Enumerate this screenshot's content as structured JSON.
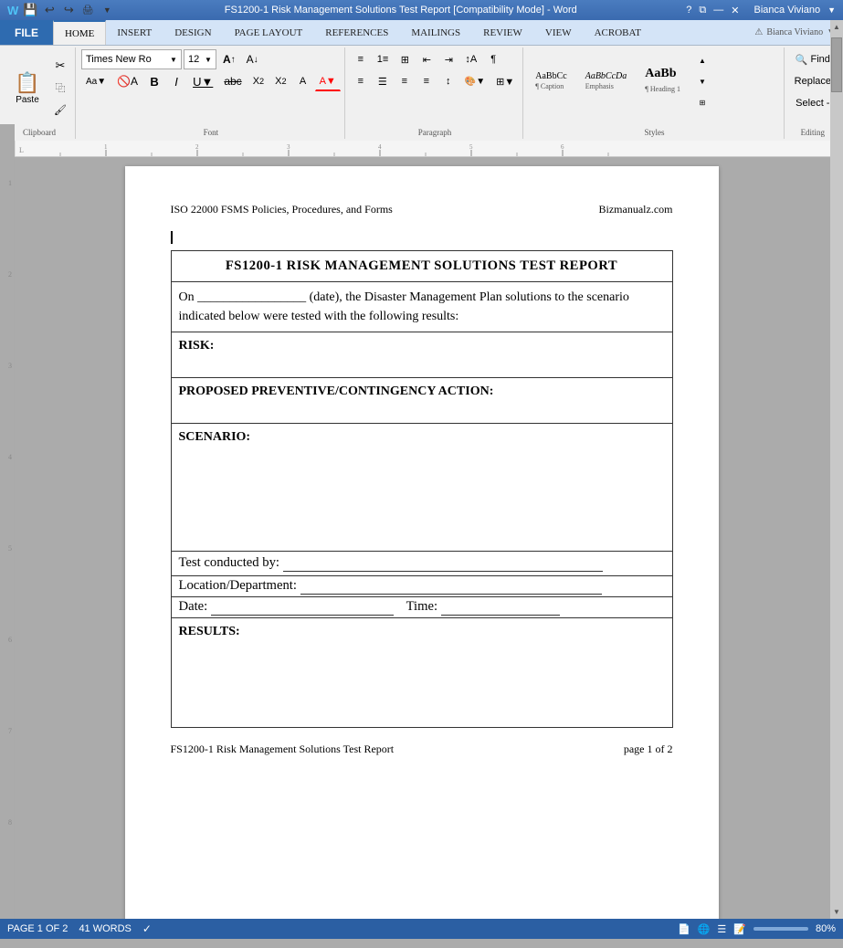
{
  "titlebar": {
    "title": "FS1200-1 Risk Management Solutions Test Report [Compatibility Mode] - Word",
    "help_icon": "?",
    "restore_icon": "⧉",
    "minimize_icon": "—",
    "close_icon": "✕",
    "user": "Bianca Viviano"
  },
  "ribbon": {
    "file_label": "FILE",
    "tabs": [
      "HOME",
      "INSERT",
      "DESIGN",
      "PAGE LAYOUT",
      "REFERENCES",
      "MAILINGS",
      "REVIEW",
      "VIEW",
      "ACROBAT"
    ],
    "active_tab": "HOME",
    "font_name": "Times New Ro",
    "font_size": "12",
    "clipboard_label": "Clipboard",
    "font_label": "Font",
    "paragraph_label": "Paragraph",
    "styles_label": "Styles",
    "editing_label": "Editing",
    "find_label": "Find",
    "replace_label": "Replace",
    "select_label": "Select -",
    "styles": [
      {
        "label": "AaBbCc",
        "name": "Caption",
        "sub": "¶ Caption"
      },
      {
        "label": "AaBbCcDa",
        "name": "Emphasis",
        "italic": true
      },
      {
        "label": "AaBb",
        "name": "Heading 1",
        "bold": true,
        "large": true
      }
    ]
  },
  "document": {
    "header_left": "ISO 22000 FSMS Policies, Procedures, and Forms",
    "header_right": "Bizmanualz.com",
    "title": "FS1200-1 RISK MANAGEMENT SOLUTIONS TEST REPORT",
    "intro": "On _________________ (date), the Disaster Management Plan solutions to the scenario indicated below were tested with the following results:",
    "risk_label": "RISK:",
    "proposed_label": "PROPOSED PREVENTIVE/CONTINGENCY ACTION:",
    "scenario_label": "SCENARIO:",
    "test_conducted_label": "Test conducted by:",
    "location_label": "Location/Department:",
    "date_label": "Date:",
    "time_label": "Time:",
    "results_label": "RESULTS:",
    "footer_left": "FS1200-1 Risk Management Solutions Test Report",
    "footer_right": "page 1 of 2"
  },
  "statusbar": {
    "page_info": "PAGE 1 OF 2",
    "word_count": "41 WORDS",
    "zoom_level": "80%"
  }
}
